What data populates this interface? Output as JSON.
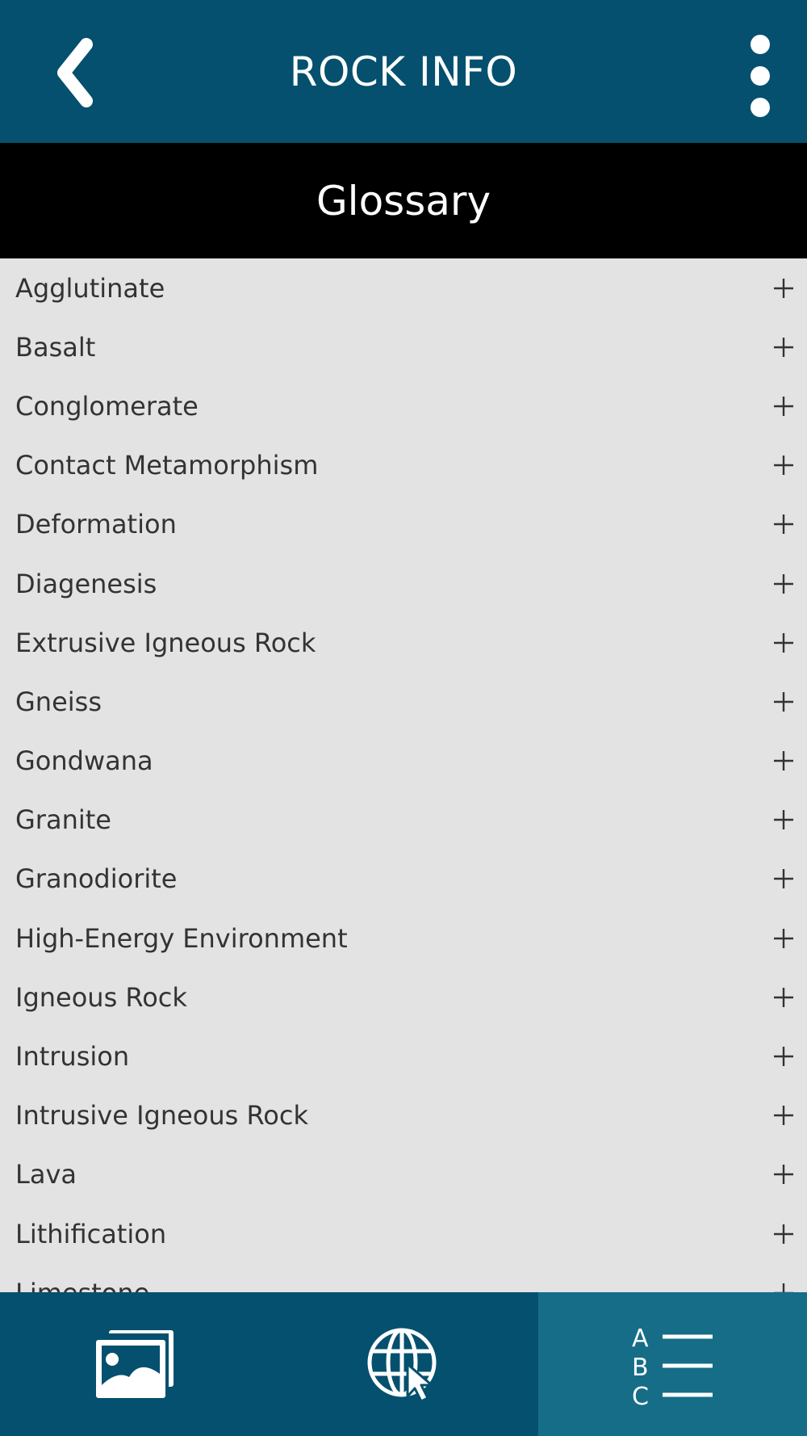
{
  "header": {
    "title": "ROCK INFO",
    "back_icon": "chevron-left-icon",
    "menu_icon": "more-vertical-icon"
  },
  "section": {
    "title": "Glossary"
  },
  "glossary": {
    "items": [
      {
        "label": "Agglutinate"
      },
      {
        "label": "Basalt"
      },
      {
        "label": "Conglomerate"
      },
      {
        "label": "Contact Metamorphism"
      },
      {
        "label": "Deformation"
      },
      {
        "label": "Diagenesis"
      },
      {
        "label": "Extrusive Igneous Rock"
      },
      {
        "label": "Gneiss"
      },
      {
        "label": "Gondwana"
      },
      {
        "label": "Granite"
      },
      {
        "label": "Granodiorite"
      },
      {
        "label": "High-Energy Environment"
      },
      {
        "label": "Igneous Rock"
      },
      {
        "label": "Intrusion"
      },
      {
        "label": "Intrusive Igneous Rock"
      },
      {
        "label": "Lava"
      },
      {
        "label": "Lithification"
      },
      {
        "label": "Limestone"
      }
    ],
    "expand_icon": "plus-icon"
  },
  "bottom_nav": {
    "tabs": [
      {
        "icon": "gallery-icon",
        "active": false
      },
      {
        "icon": "web-globe-icon",
        "active": false
      },
      {
        "icon": "abc-list-icon",
        "active": true
      }
    ]
  },
  "colors": {
    "primary": "#04506e",
    "active_tab": "#156d88",
    "section_header": "#000000",
    "list_background": "#e3e3e3",
    "text": "#333333"
  }
}
